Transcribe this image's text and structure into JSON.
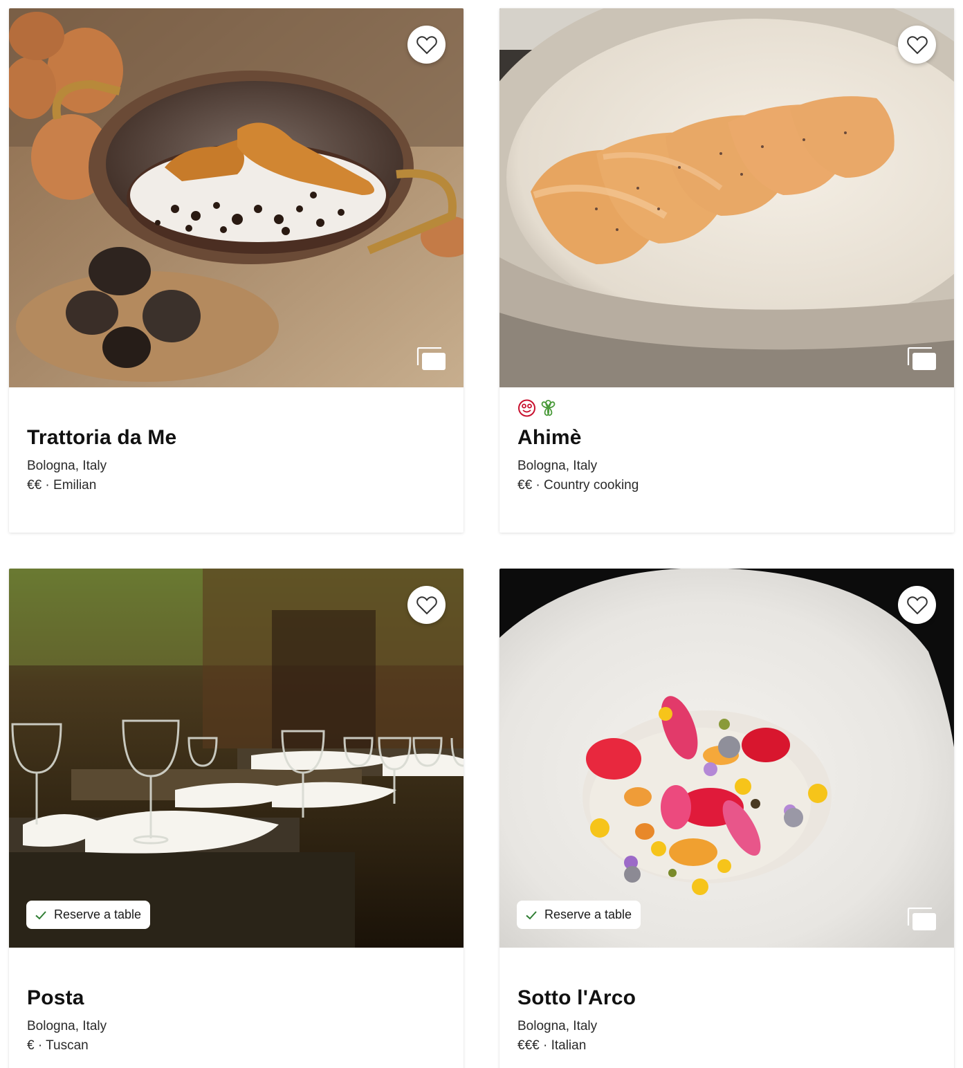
{
  "restaurants": [
    {
      "name": "Trattoria da Me",
      "location": "Bologna, Italy",
      "price_cuisine": "€€ · Emilian",
      "has_awards": false,
      "reserve_label": "",
      "photo_subject": "truffle-dish-in-copper-pan"
    },
    {
      "name": "Ahimè",
      "location": "Bologna, Italy",
      "price_cuisine": "€€ · Country cooking",
      "has_awards": true,
      "awards": [
        "bib-gourmand-icon",
        "green-star-icon"
      ],
      "reserve_label": "",
      "photo_subject": "seared-prawns-on-clay-plate"
    },
    {
      "name": "Posta",
      "location": "Bologna, Italy",
      "price_cuisine": "€ · Tuscan",
      "has_awards": false,
      "reserve_label": "Reserve a table",
      "photo_subject": "restaurant-tables-with-glasses"
    },
    {
      "name": "Sotto l'Arco",
      "location": "Bologna, Italy",
      "price_cuisine": "€€€ · Italian",
      "has_awards": false,
      "reserve_label": "Reserve a table",
      "photo_subject": "flower-garnished-plate"
    }
  ],
  "icons": {
    "favorite": "heart-outline-icon",
    "gallery": "gallery-stack-icon",
    "check": "check-icon"
  },
  "colors": {
    "bib_red": "#c8102e",
    "green_star": "#4a9a3a",
    "check_green": "#2e7d32"
  }
}
